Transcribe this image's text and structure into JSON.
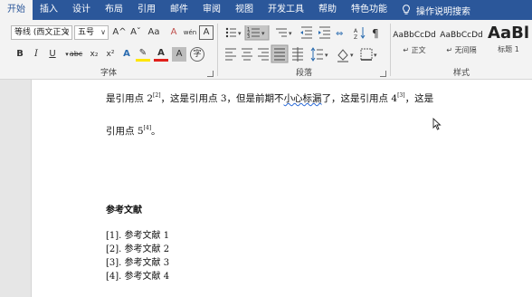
{
  "tabs": [
    {
      "label": "开始",
      "active": true
    },
    {
      "label": "插入"
    },
    {
      "label": "设计"
    },
    {
      "label": "布局"
    },
    {
      "label": "引用"
    },
    {
      "label": "邮件"
    },
    {
      "label": "审阅"
    },
    {
      "label": "视图"
    },
    {
      "label": "开发工具"
    },
    {
      "label": "帮助"
    },
    {
      "label": "特色功能"
    }
  ],
  "tell_me": "操作说明搜索",
  "ribbon": {
    "font": {
      "family": "等线 (西文正文",
      "size": "五号",
      "grow": "A^",
      "shrink": "Aˇ",
      "change_case": "Aa",
      "clear": "A",
      "phonetic": "wén",
      "border": "A",
      "bold": "B",
      "italic": "I",
      "underline": "U",
      "strike": "abc",
      "subscript": "x₂",
      "superscript": "x²",
      "text_effects": "A",
      "highlight": "✎",
      "font_color": "A",
      "shading": "A",
      "enclose": "字",
      "label": "字体"
    },
    "paragraph": {
      "label": "段落"
    },
    "styles": {
      "label": "样式",
      "items": [
        {
          "preview": "AaBbCcDd",
          "name": "↵ 正文"
        },
        {
          "preview": "AaBbCcDd",
          "name": "↵ 无间隔"
        },
        {
          "preview": "AaBl",
          "name": "标题 1"
        }
      ]
    }
  },
  "document": {
    "line1": {
      "a": "是引用点 2",
      "a_sup": "[2]",
      "b": "，这是引用点 3，但是前期不",
      "squiggle": "小心标漏",
      "c": "了，这是引用点 4",
      "c_sup": "[3]",
      "d": "，这是"
    },
    "line2": {
      "a": "引用点 5",
      "a_sup": "[4]",
      "b": "。"
    },
    "heading": "参考文献",
    "refs": [
      "[1].  参考文献 1",
      "[2].  参考文献 2",
      "[3].  参考文献 3",
      "[4].  参考文献 4"
    ]
  }
}
